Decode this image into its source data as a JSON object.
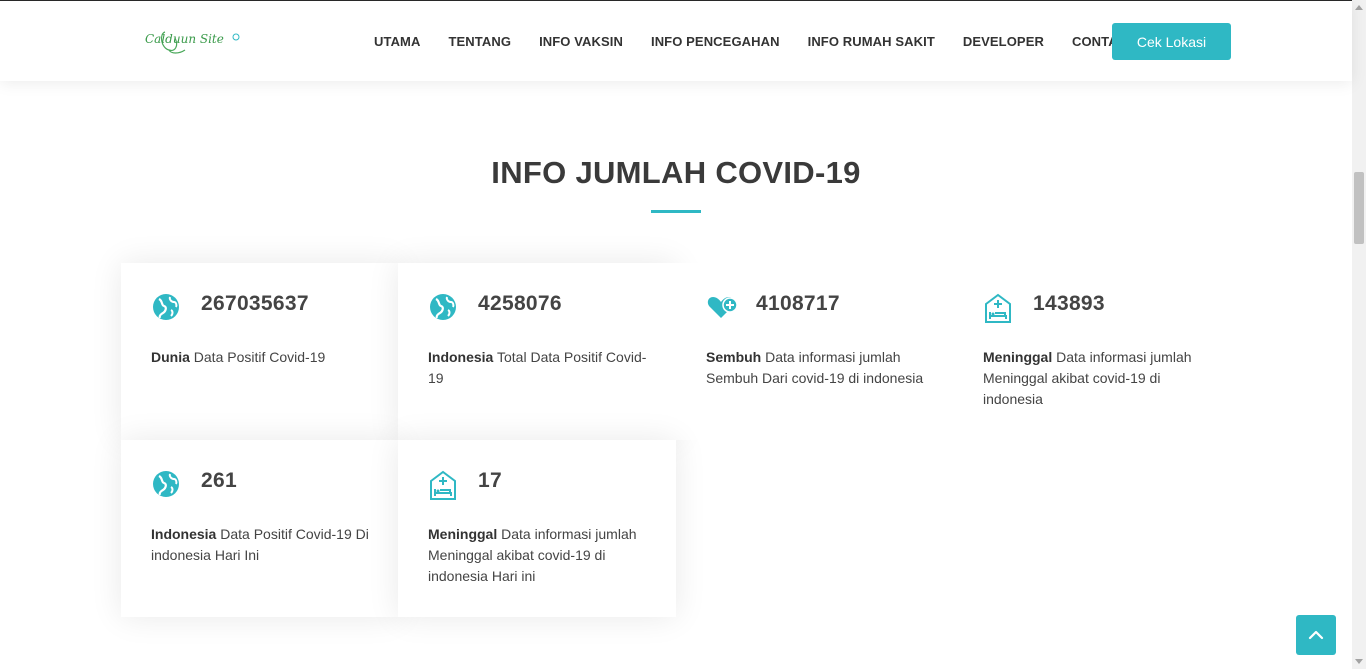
{
  "header": {
    "logo_text": "Calduun Site",
    "nav": [
      "UTAMA",
      "TENTANG",
      "INFO VAKSIN",
      "INFO PENCEGAHAN",
      "INFO RUMAH SAKIT",
      "DEVELOPER",
      "CONTACT"
    ],
    "cta_label": "Cek Lokasi"
  },
  "section": {
    "title": "INFO JUMLAH COVID-19"
  },
  "cards": [
    {
      "icon": "globe-icon",
      "value": "267035637",
      "label": "Dunia",
      "text": " Data Positif Covid-19"
    },
    {
      "icon": "globe-icon",
      "value": "4258076",
      "label": "Indonesia",
      "text": " Total Data Positif Covid-19"
    },
    {
      "icon": "heart-plus-icon",
      "value": "4108717",
      "label": "Sembuh",
      "text": " Data informasi jumlah Sembuh Dari covid-19 di indonesia"
    },
    {
      "icon": "hospital-bed-icon",
      "value": "143893",
      "label": "Meninggal",
      "text": " Data informasi jumlah Meninggal akibat covid-19 di indonesia"
    },
    {
      "icon": "globe-icon",
      "value": "261",
      "label": "Indonesia",
      "text": " Data Positif Covid-19 Di indonesia Hari Ini"
    },
    {
      "icon": "hospital-bed-icon",
      "value": "17",
      "label": "Meninggal",
      "text": " Data informasi jumlah Meninggal akibat covid-19 di indonesia Hari ini"
    }
  ],
  "colors": {
    "accent": "#2fb8c4",
    "text_dark": "#3a3a3a"
  }
}
